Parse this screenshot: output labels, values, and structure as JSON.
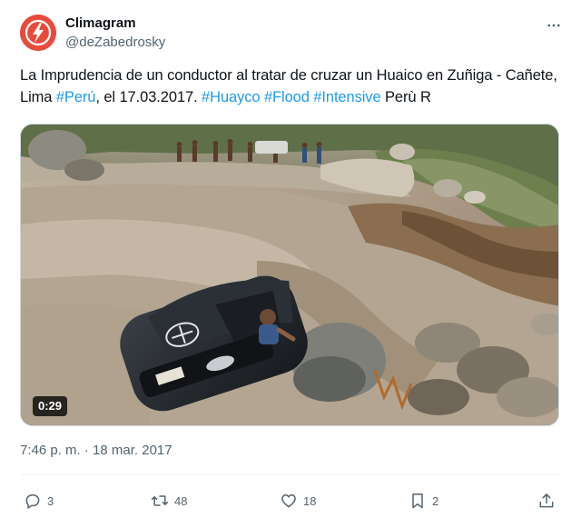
{
  "author": {
    "name": "Climagram",
    "handle": "@deZabedrosky",
    "avatar_color": "#e84b3c"
  },
  "tweet": {
    "text_parts": {
      "p1": "La Imprudencia de un conductor al tratar de cruzar un Huaico en Zuñiga - Cañete, Lima ",
      "tag1": "#Perú",
      "p2": ", el 17.03.2017. ",
      "tag2": "#Huayco",
      "p3": " ",
      "tag3": "#Flood",
      "p4": " ",
      "tag4": "#Intensive",
      "p5": " Perù R"
    },
    "link_color": "#1d9bf0"
  },
  "media": {
    "duration": "0:29"
  },
  "timestamp": "7:46 p. m. · 18 mar. 2017",
  "actions": {
    "replies": "3",
    "retweets": "48",
    "likes": "18",
    "bookmarks": "2"
  },
  "icons": [
    "more-icon",
    "reply-icon",
    "retweet-icon",
    "like-icon",
    "bookmark-icon",
    "share-icon"
  ]
}
